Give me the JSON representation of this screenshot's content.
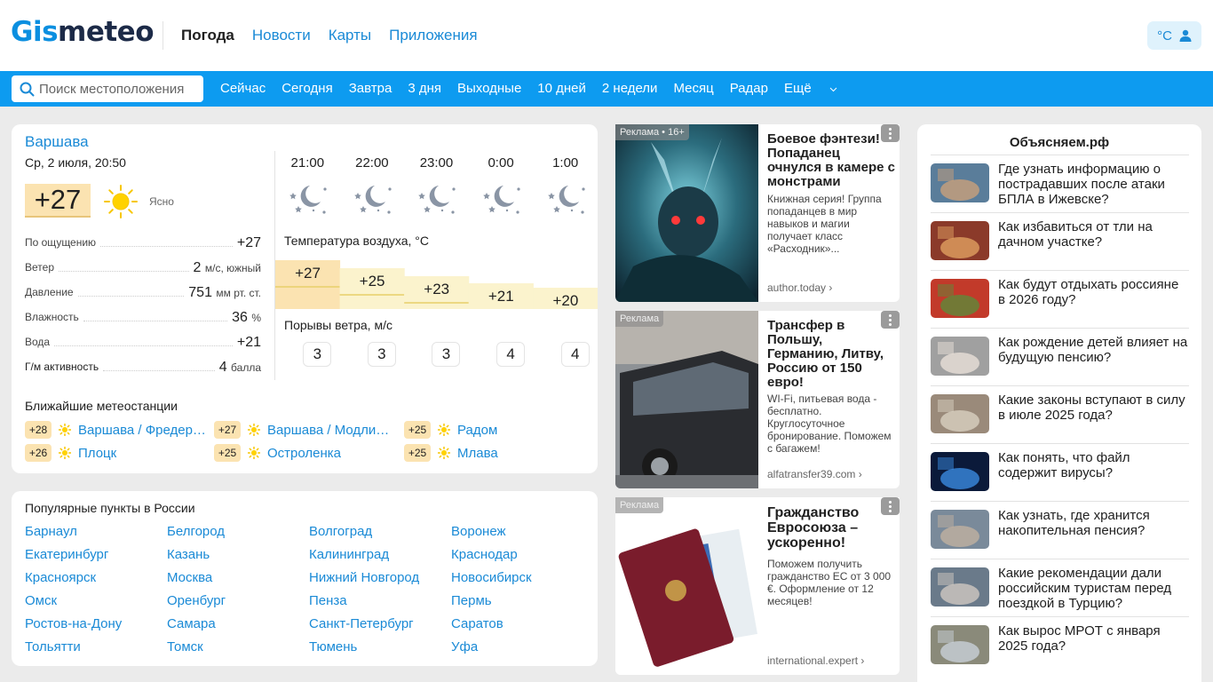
{
  "header": {
    "logo_part1": "Gis",
    "logo_part2": "meteo",
    "nav": [
      "Погода",
      "Новости",
      "Карты",
      "Приложения"
    ],
    "unit_label": "°C"
  },
  "subnav": {
    "search_placeholder": "Поиск местоположения",
    "items": [
      "Сейчас",
      "Сегодня",
      "Завтра",
      "3 дня",
      "Выходные",
      "10 дней",
      "2 недели",
      "Месяц",
      "Радар",
      "Ещё"
    ]
  },
  "weather": {
    "city": "Варшава",
    "date": "Ср, 2 июля, 20:50",
    "temp": "+27",
    "condition": "Ясно",
    "params": [
      {
        "label": "По ощущению",
        "value": "+27",
        "unit": ""
      },
      {
        "label": "Ветер",
        "value": "2",
        "unit": "м/с, южный"
      },
      {
        "label": "Давление",
        "value": "751",
        "unit": "мм рт. ст."
      },
      {
        "label": "Влажность",
        "value": "36",
        "unit": "%"
      },
      {
        "label": "Вода",
        "value": "+21",
        "unit": ""
      },
      {
        "label": "Г/м активность",
        "value": "4",
        "unit": "балла"
      }
    ],
    "hours": [
      "21:00",
      "22:00",
      "23:00",
      "0:00",
      "1:00"
    ],
    "temp_title": "Температура воздуха, °C",
    "hourly_temps": [
      "+27",
      "+25",
      "+23",
      "+21",
      "+20"
    ],
    "hourly_temp_values": [
      27,
      25,
      23,
      21,
      20
    ],
    "gust_title": "Порывы ветра, м/с",
    "gusts": [
      "3",
      "3",
      "3",
      "4",
      "4"
    ],
    "nearest_title": "Ближайшие метеостанции",
    "stations": [
      {
        "temp": "+28",
        "name": "Варшава / Фредерика Шопена"
      },
      {
        "temp": "+27",
        "name": "Варшава / Модлин Мазовецкий"
      },
      {
        "temp": "+25",
        "name": "Радом"
      },
      {
        "temp": "+26",
        "name": "Плоцк"
      },
      {
        "temp": "+25",
        "name": "Остроленка"
      },
      {
        "temp": "+25",
        "name": "Млава"
      }
    ]
  },
  "popular": {
    "title": "Популярные пункты в России",
    "cities": [
      "Барнаул",
      "Белгород",
      "Волгоград",
      "Воронеж",
      "Екатеринбург",
      "Казань",
      "Калининград",
      "Краснодар",
      "Красноярск",
      "Москва",
      "Нижний Новгород",
      "Новосибирск",
      "Омск",
      "Оренбург",
      "Пенза",
      "Пермь",
      "Ростов-на-Дону",
      "Самара",
      "Санкт-Петербург",
      "Саратов",
      "Тольятти",
      "Томск",
      "Тюмень",
      "Уфа"
    ]
  },
  "ads": [
    {
      "tag": "Реклама • 16+",
      "title": "Боевое фэнтези! Попаданец очнулся в камере с монстрами",
      "desc": "Книжная серия! Группа попаданцев в мир навыков и магии получает класс «Расходник»...",
      "source": "author.today"
    },
    {
      "tag": "Реклама",
      "title": "Трансфер в Польшу, Германию, Литву, Россию от 150 евро!",
      "desc": "WI-Fi, питьевая вода - бесплатно. Круглосуточное бронирование. Поможем с багажем!",
      "source": "alfatransfer39.com"
    },
    {
      "tag": "Реклама",
      "title": "Гражданство Евросоюза – ускоренно!",
      "desc": "Поможем получить гражданство ЕС от 3 000 €. Оформление от 12 месяцев!",
      "source": "international.expert"
    }
  ],
  "explainers": {
    "title": "Объясняем.рф",
    "items": [
      "Где узнать информацию о пострадавших после атаки БПЛА в Ижевске?",
      "Как избавиться от тли на дачном участке?",
      "Как будут отдыхать россияне в 2026 году?",
      "Как рождение детей влияет на будущую пенсию?",
      "Какие законы вступают в силу в июле 2025 года?",
      "Как понять, что файл содержит вирусы?",
      "Как узнать, где хранится накопительная пенсия?",
      "Какие рекомендации дали российским туристам перед поездкой в Турцию?",
      "Как вырос МРОТ с января 2025 года?"
    ]
  },
  "colors": {
    "accent": "#0d9bf0",
    "link": "#1a8ad6",
    "temp_bg": "#fbe3b1"
  }
}
